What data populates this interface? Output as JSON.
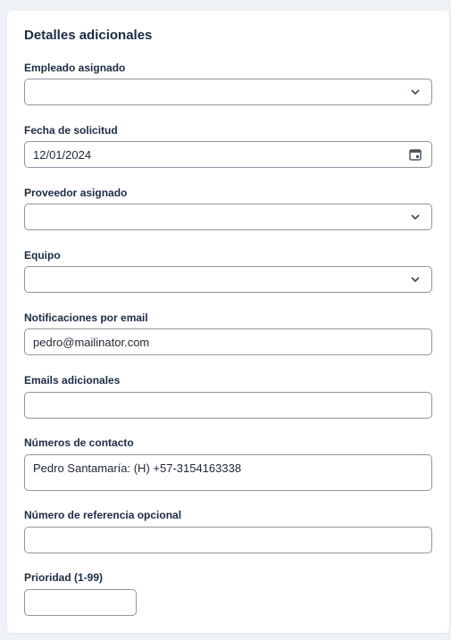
{
  "section": {
    "title": "Detalles adicionales"
  },
  "fields": {
    "empleado": {
      "label": "Empleado asignado",
      "value": ""
    },
    "fecha": {
      "label": "Fecha de solicitud",
      "value": "12/01/2024"
    },
    "proveedor": {
      "label": "Proveedor asignado",
      "value": ""
    },
    "equipo": {
      "label": "Equipo",
      "value": ""
    },
    "notificaciones": {
      "label": "Notificaciones por email",
      "value": "pedro@mailinator.com"
    },
    "emails_adicionales": {
      "label": "Emails adicionales",
      "value": ""
    },
    "contacto": {
      "label": "Números de contacto",
      "value": "Pedro Santamaría: (H) +57-3154163338"
    },
    "referencia": {
      "label": "Número de referencia opcional",
      "value": ""
    },
    "prioridad": {
      "label": "Prioridad (1-99)",
      "value": ""
    }
  },
  "icons": {
    "dropdown": "chevron-down-icon",
    "date": "calendar-icon"
  },
  "colors": {
    "text": "#1b2b45",
    "border": "#8c96a3",
    "background": "#eef1f5"
  }
}
